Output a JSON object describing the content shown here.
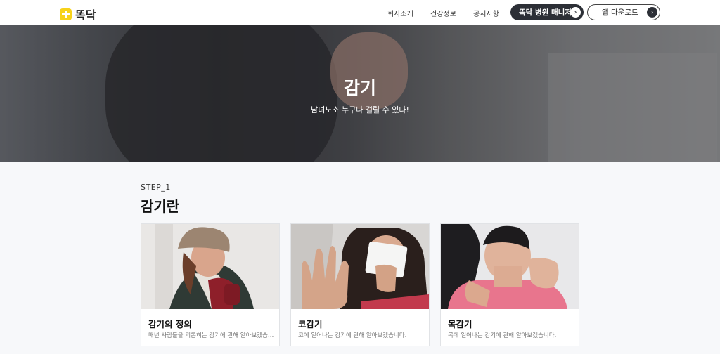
{
  "header": {
    "logo_text": "똑닥",
    "nav": [
      "회사소개",
      "건강정보",
      "공지사항"
    ],
    "manager_button": "똑닥 병원 매니저",
    "download_button": "앱 다운로드"
  },
  "hero": {
    "title": "감기",
    "subtitle": "남녀노소 누구나 걸릴 수 있다!"
  },
  "section": {
    "step": "STEP_1",
    "title": "감기란"
  },
  "cards": [
    {
      "title": "감기의 정의",
      "desc": "매년 사람들을 괴롭히는 감기에 관해 알아보겠습니다."
    },
    {
      "title": "코감기",
      "desc": "코에 일어나는 감기에 관해 알아보겠습니다."
    },
    {
      "title": "목감기",
      "desc": "목에 일어나는 감기에 관해 알아보겠습니다."
    }
  ]
}
